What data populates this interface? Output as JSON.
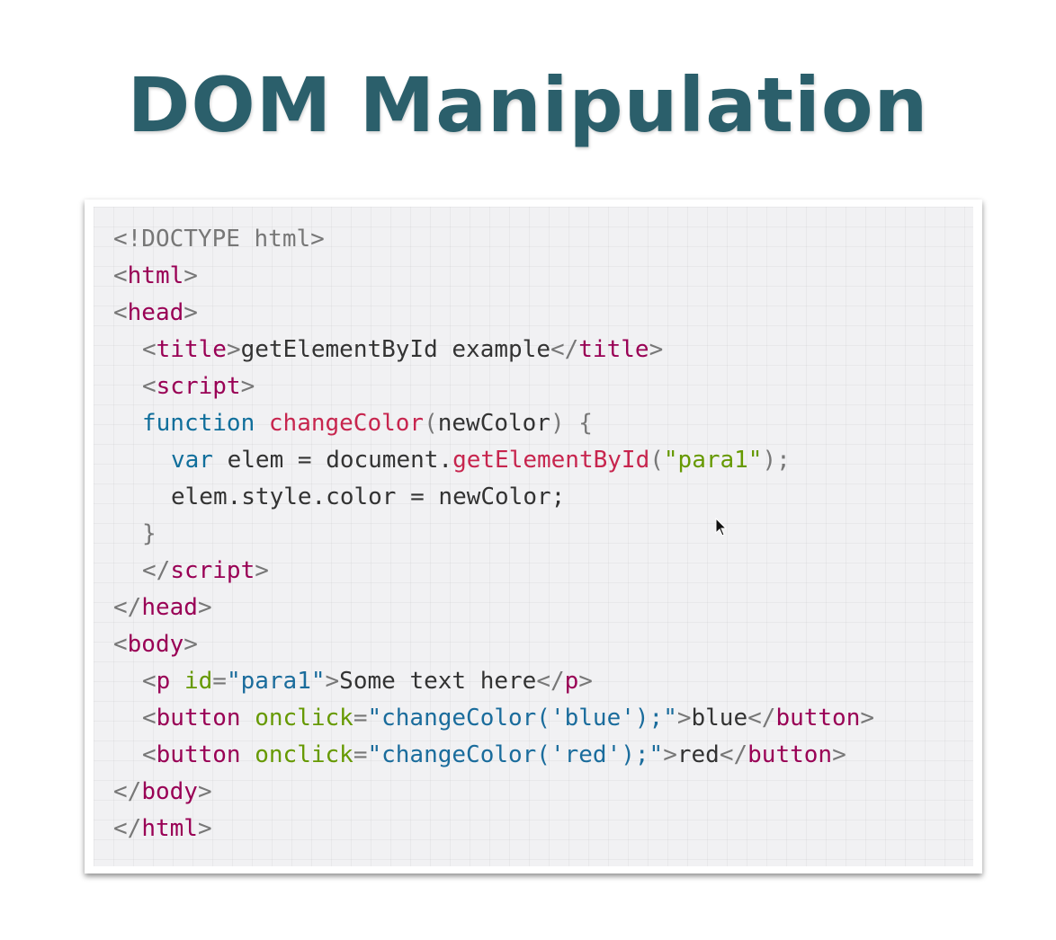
{
  "slide": {
    "title": "DOM Manipulation"
  },
  "code": {
    "doctype": "<!DOCTYPE html>",
    "html_tag": "html",
    "head_tag": "head",
    "title_tag": "title",
    "title_text": "getElementById example",
    "script_tag": "script",
    "function_kw": "function",
    "function_name": "changeColor",
    "param": "newColor",
    "var_kw": "var",
    "elem_decl": " elem = document.",
    "get_fn": "getElementById",
    "para_str": "\"para1\"",
    "assign_line": "elem.style.color = newColor;",
    "body_tag": "body",
    "p_tag": "p",
    "id_attr": "id",
    "id_value": "\"para1\"",
    "p_text": "Some text here",
    "button_tag": "button",
    "onclick_attr": "onclick",
    "blue_handler": "\"changeColor('blue');\"",
    "blue_label": "blue",
    "red_handler": "\"changeColor('red');\"",
    "red_label": "red"
  },
  "icons": {
    "cursor": "mouse-pointer-icon"
  }
}
